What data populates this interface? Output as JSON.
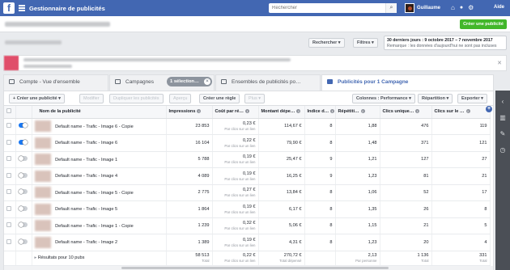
{
  "topbar": {
    "app_title": "Gestionnaire de publicités",
    "search_placeholder": "Rechercher",
    "account_name": "Guillaume",
    "help_label": "Aide"
  },
  "subheader": {
    "create_ad_label": "Créer une publicité"
  },
  "filters": {
    "search_label": "Rechercher",
    "filters_label": "Filtres",
    "date_range": "30 derniers jours : 9 octobre 2017 – 7 novembre 2017",
    "date_note": "Remarque : les données d'aujourd'hui ne sont pas incluses"
  },
  "tabs": [
    {
      "label": "Compte - Vue d'ensemble"
    },
    {
      "label": "Campagnes"
    },
    {
      "label": "Ensembles de publicités po…"
    },
    {
      "label": "Publicités pour 1 Campagne"
    }
  ],
  "selection_pill": "1 sélection…",
  "actions": {
    "create": "+ Créer une publicité",
    "modify": "Modifier",
    "duplicate": "Dupliquer les publicités",
    "preview": "Aperçu",
    "create_rule": "Créer une règle",
    "more": "Plus",
    "columns": "Colonnes : Performance",
    "breakdown": "Répartition",
    "export": "Exporter"
  },
  "table": {
    "headers": [
      "Nom de la publicité",
      "Impressions",
      "Coût par ré…",
      "Montant dépe…",
      "Indice d…",
      "Répétiti…",
      "Clics unique…",
      "Clics sur le …"
    ],
    "subnote": "Par clics sur un lien",
    "rows": [
      {
        "name": "Default name - Trafic - Image 6 - Copie",
        "on": true,
        "impressions": "23 853",
        "cost": "0,23 €",
        "spent": "114,67 €",
        "index": "8",
        "freq": "1,88",
        "unique": "476",
        "clicks": "119"
      },
      {
        "name": "Default name - Trafic - Image 6",
        "on": true,
        "impressions": "16 104",
        "cost": "0,22 €",
        "spent": "79,90 €",
        "index": "8",
        "freq": "1,48",
        "unique": "371",
        "clicks": "121"
      },
      {
        "name": "Default name - Trafic - Image 1",
        "on": false,
        "impressions": "5 788",
        "cost": "0,19 €",
        "spent": "25,47 €",
        "index": "9",
        "freq": "1,21",
        "unique": "127",
        "clicks": "27"
      },
      {
        "name": "Default name - Trafic - Image 4",
        "on": false,
        "impressions": "4 089",
        "cost": "0,19 €",
        "spent": "16,25 €",
        "index": "9",
        "freq": "1,23",
        "unique": "81",
        "clicks": "21"
      },
      {
        "name": "Default name - Trafic - Image 5 - Copie",
        "on": false,
        "impressions": "2 775",
        "cost": "0,27 €",
        "spent": "13,84 €",
        "index": "8",
        "freq": "1,06",
        "unique": "52",
        "clicks": "17"
      },
      {
        "name": "Default name - Trafic - Image 5",
        "on": false,
        "impressions": "1 864",
        "cost": "0,19 €",
        "spent": "6,17 €",
        "index": "8",
        "freq": "1,35",
        "unique": "26",
        "clicks": "8"
      },
      {
        "name": "Default name - Trafic - Image 1 - Copie",
        "on": false,
        "impressions": "1 239",
        "cost": "0,32 €",
        "spent": "5,06 €",
        "index": "8",
        "freq": "1,15",
        "unique": "21",
        "clicks": "5"
      },
      {
        "name": "Default name - Trafic - Image 2",
        "on": false,
        "impressions": "1 389",
        "cost": "0,19 €",
        "spent": "4,31 €",
        "index": "8",
        "freq": "1,23",
        "unique": "20",
        "clicks": "4"
      }
    ],
    "total": {
      "label": "Résultats pour 10 pubs",
      "impressions": "58 513",
      "impressions_sub": "Total",
      "cost": "0,22 €",
      "cost_sub": "Par clics sur un lien",
      "spent": "270,72 €",
      "spent_sub": "Total dépensé",
      "freq": "2,13",
      "freq_sub": "Par personne",
      "unique": "1 136",
      "unique_sub": "Total",
      "clicks": "331",
      "clicks_sub": "Total"
    }
  },
  "icons": {
    "fb_logo": "f",
    "search": "⌕",
    "home": "⌂",
    "bell": "🔔",
    "gear": "⚙"
  }
}
